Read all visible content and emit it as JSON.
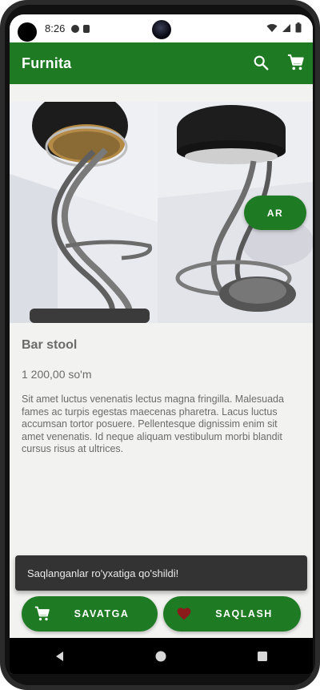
{
  "status_bar": {
    "time": "8:26"
  },
  "app_bar": {
    "title": "Furnita"
  },
  "product": {
    "ar_label": "AR",
    "name": "Bar stool",
    "price": "1 200,00 so'm",
    "description": "Sit amet luctus venenatis lectus magna fringilla. Malesuada fames ac turpis egestas maecenas pharetra. Lacus luctus accumsan tortor posuere. Pellentesque dignissim enim sit amet venenatis. Id neque aliquam vestibulum morbi blandit cursus risus at ultrices."
  },
  "snackbar": {
    "message": "Saqlanganlar ro'yxatiga qo'shildi!"
  },
  "actions": {
    "cart_label": "SAVATGA",
    "save_label": "SAQLASH"
  },
  "colors": {
    "primary": "#1e7a23",
    "heart": "#8b1a1a",
    "snackbar": "#333333"
  }
}
